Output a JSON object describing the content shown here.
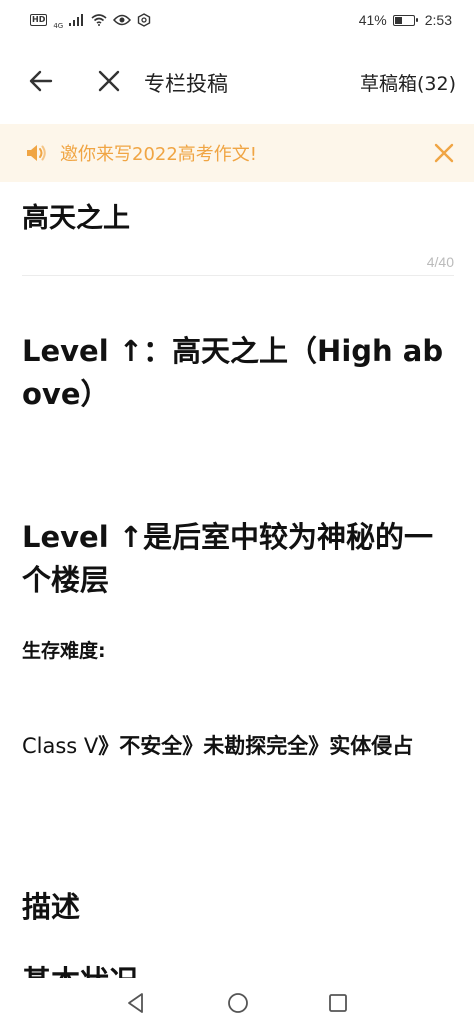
{
  "status_bar": {
    "hd_badge": "HD",
    "network_badge": "4G",
    "battery_percent": "41%",
    "battery_level": 0.41,
    "time": "2:53"
  },
  "app_bar": {
    "title": "专栏投稿",
    "drafts_label": "草稿箱(32)",
    "back_icon": "arrow-left-icon",
    "close_icon": "close-icon"
  },
  "banner": {
    "text": "邀你来写2022高考作文!",
    "icon": "speaker-icon",
    "color": "#f0a544",
    "background": "#fdf6ea"
  },
  "editor": {
    "title": "高天之上",
    "char_count": "4/40",
    "blocks": {
      "heading_level": "Level ↑：高天之上（High above）",
      "heading_intro": "Level ↑是后室中较为神秘的一个楼层",
      "survival_label": "生存难度:",
      "class_prefix": "Class V",
      "class_rest": "》不安全》未勘探完全》实体侵占",
      "heading_description": "描述",
      "heading_partial": "基本状况"
    }
  },
  "nav_bar": {
    "back_icon": "triangle-back-icon",
    "home_icon": "circle-home-icon",
    "recent_icon": "square-recent-icon"
  }
}
